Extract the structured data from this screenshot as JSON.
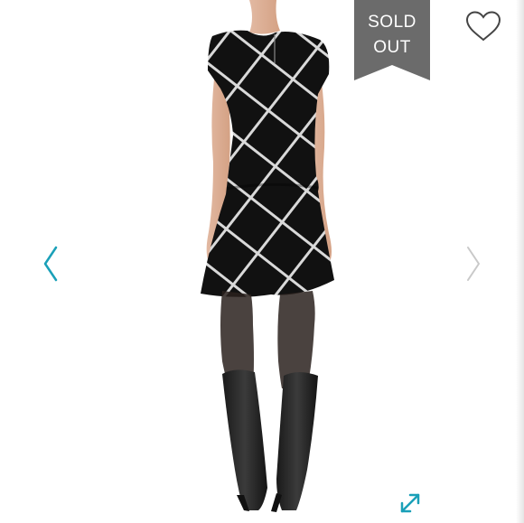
{
  "listing": {
    "status_badge": {
      "line1": "SOLD",
      "line2": "OUT",
      "color": "#6b6b6b"
    },
    "icons": {
      "like": "heart-outline-icon",
      "previous": "chevron-left-icon",
      "next": "chevron-right-icon",
      "fullscreen": "expand-arrows-icon"
    },
    "accent_color": "#1aa0b8"
  }
}
